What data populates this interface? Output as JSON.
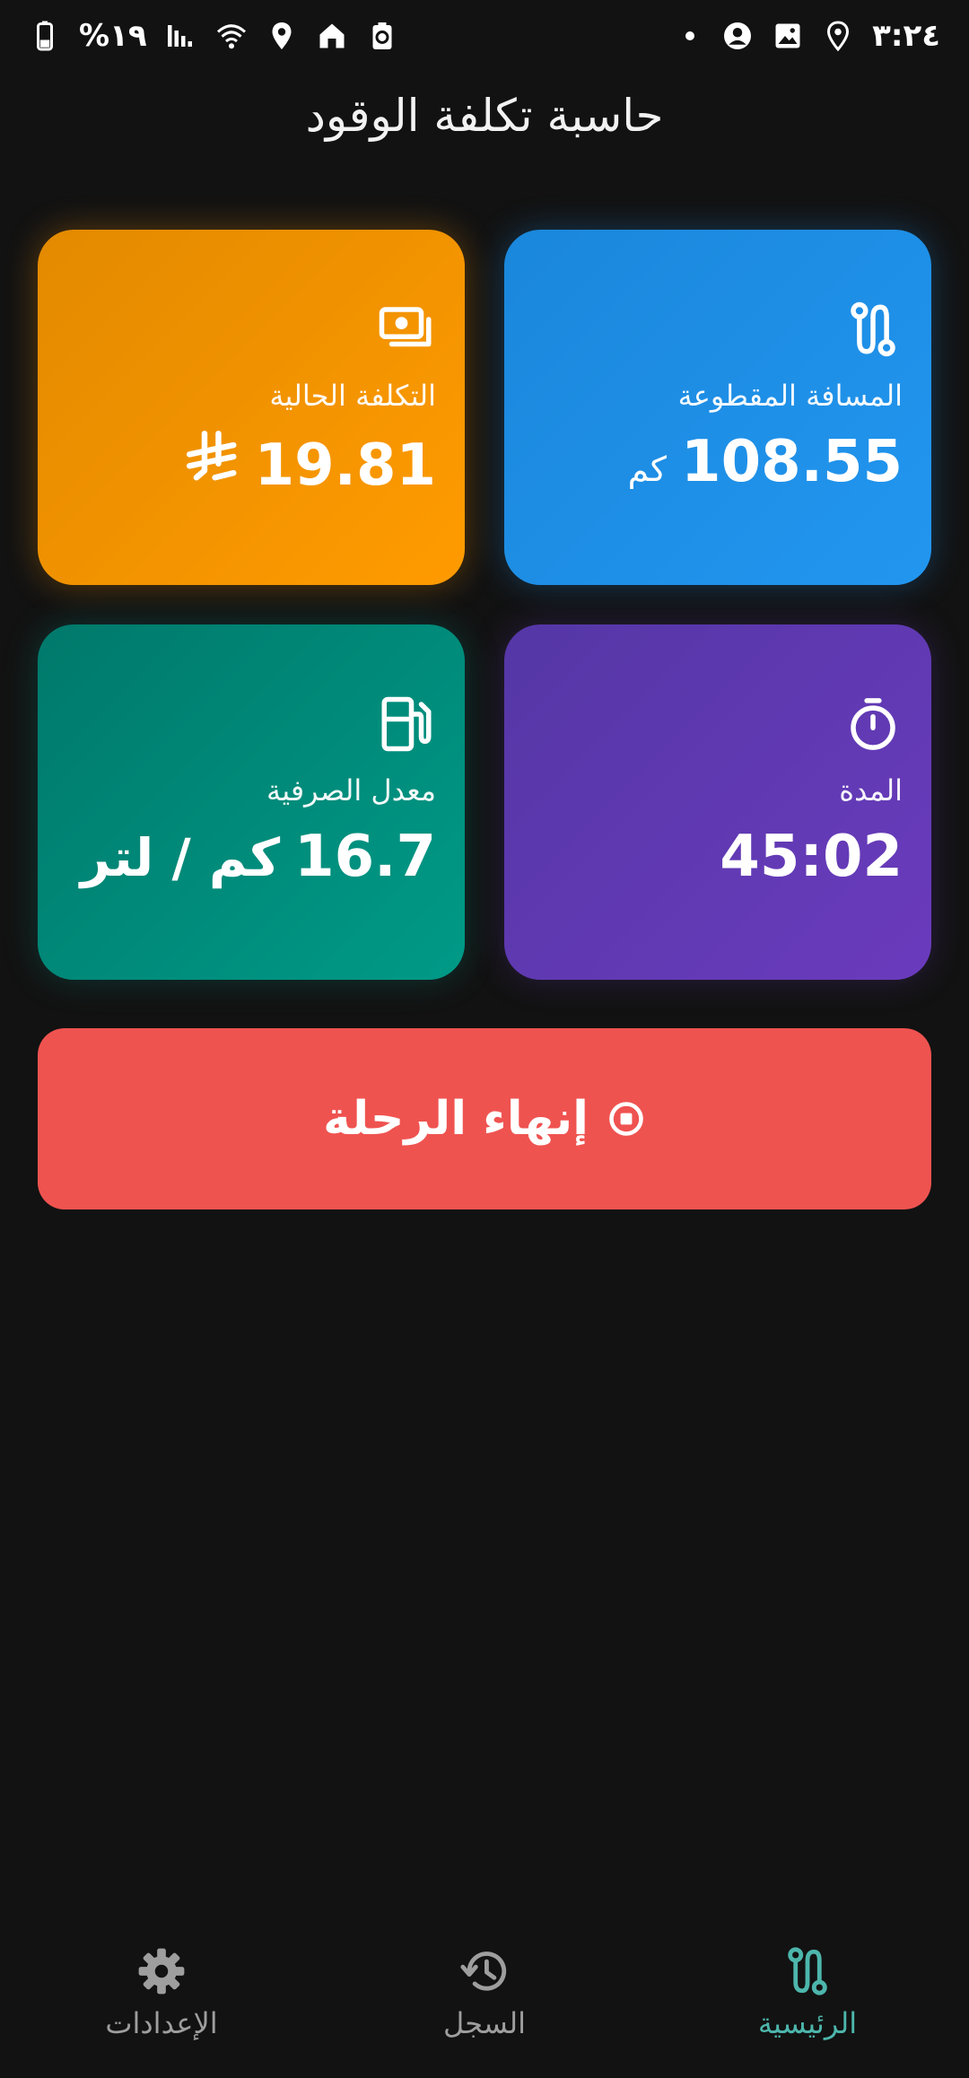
{
  "status_bar": {
    "time": "٣:٢٤",
    "battery_text": "%١٩",
    "icons_right": [
      "notification-dot-icon",
      "account-icon",
      "image-icon",
      "location-icon"
    ],
    "icons_left": [
      "battery-icon",
      "signal-icon",
      "wifi-icon",
      "location-icon",
      "home-icon",
      "recycle-icon"
    ]
  },
  "app": {
    "title": "حاسبة تكلفة الوقود"
  },
  "cards": {
    "distance": {
      "label": "المسافة المقطوعة",
      "value": "108.55",
      "unit": "كم",
      "icon": "route-icon",
      "color": "#2196F3"
    },
    "cost": {
      "label": "التكلفة الحالية",
      "value": "19.81",
      "icon": "money-icon",
      "currency_icon": "saudi-riyal-icon",
      "color": "#FF9800"
    },
    "duration": {
      "label": "المدة",
      "value": "45:02",
      "icon": "timer-icon",
      "color": "#673AB7"
    },
    "efficiency": {
      "label": "معدل الصرفية",
      "value": "16.7",
      "unit": "كم / لتر",
      "icon": "fuel-pump-icon",
      "color": "#009688"
    }
  },
  "end_trip": {
    "label": "إنهاء الرحلة",
    "icon": "stop-circle-icon",
    "color": "#EF5350"
  },
  "bottom_nav": {
    "home": {
      "label": "الرئيسية",
      "icon": "route-icon",
      "active": true
    },
    "history": {
      "label": "السجل",
      "icon": "history-icon",
      "active": false
    },
    "settings": {
      "label": "الإعدادات",
      "icon": "gear-icon",
      "active": false
    },
    "active_color": "#4DB6AC",
    "inactive_color": "#9E9E9E"
  }
}
